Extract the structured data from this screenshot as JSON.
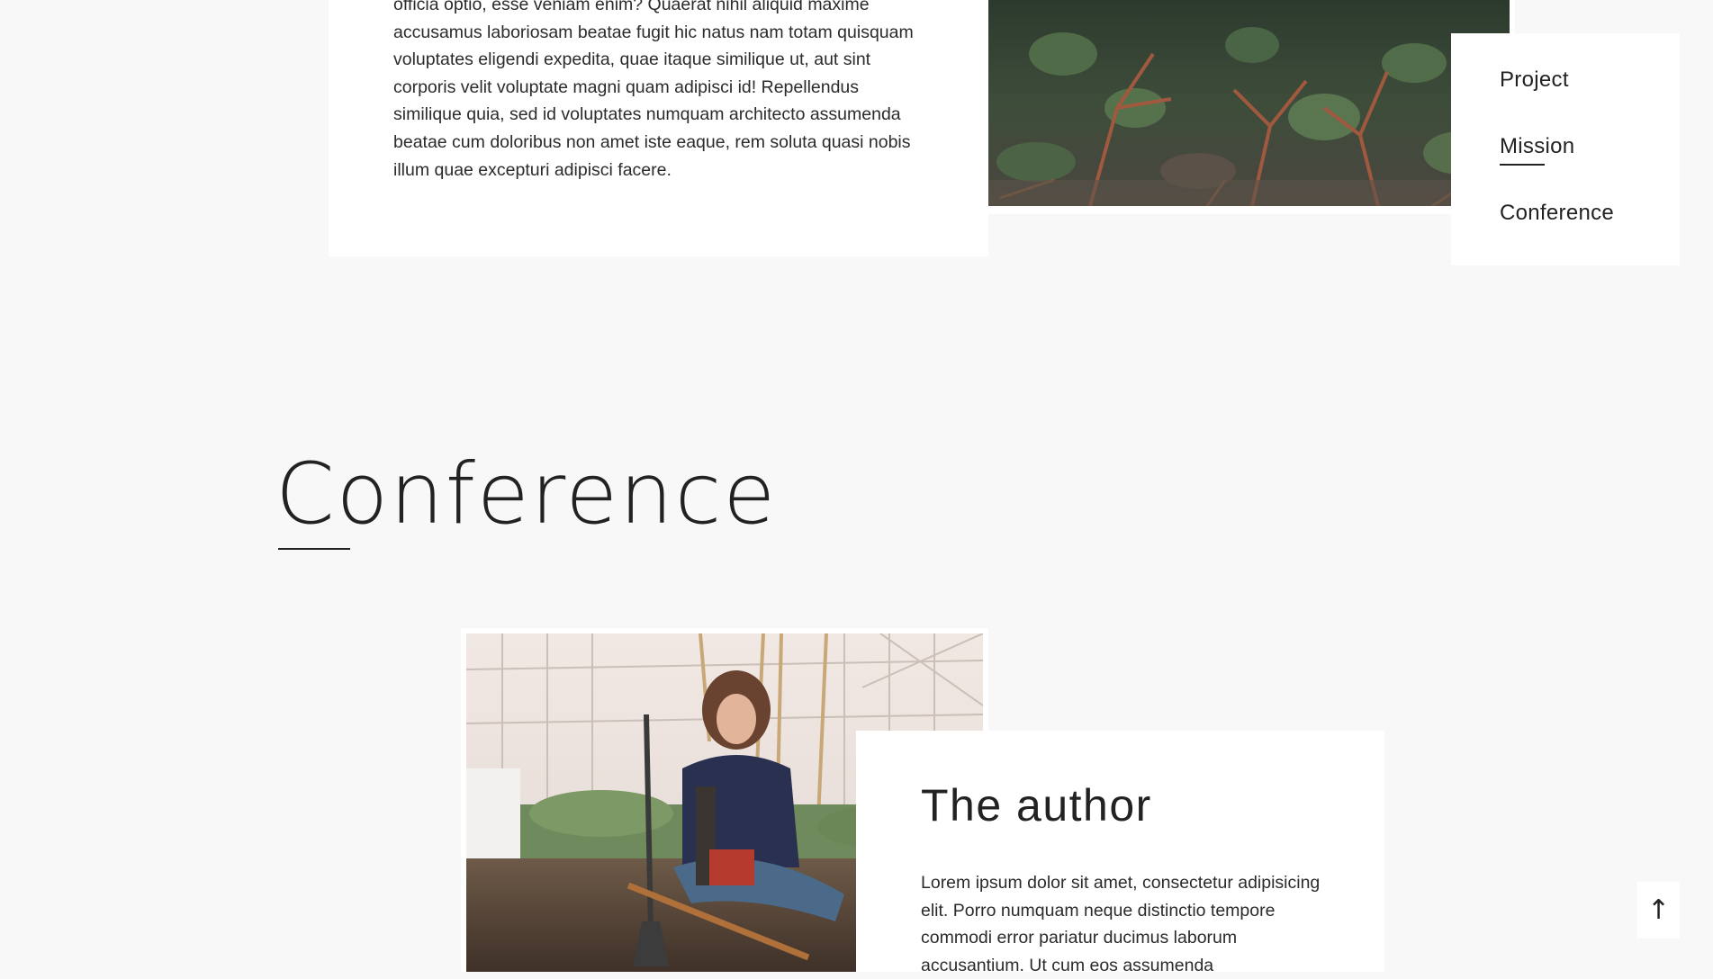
{
  "top_card": {
    "paragraph": "officia optio, esse veniam enim? Quaerat nihil aliquid maxime accusamus laboriosam beatae fugit hic natus nam totam quisquam voluptates eligendi expedita, quae itaque similique ut, aut sint corporis velit voluptate magni quam adipisci id! Repellendus similique quia, sed id voluptates numquam architecto assumenda beatae cum doloribus non amet iste eaque, rem soluta quasi nobis illum quae excepturi adipisci facere."
  },
  "nav": {
    "items": [
      {
        "label": "Project"
      },
      {
        "label": "Mission"
      },
      {
        "label": "Conference"
      }
    ],
    "active": "Mission"
  },
  "section": {
    "title": "Conference"
  },
  "author_card": {
    "heading": "The author",
    "paragraph": "Lorem ipsum dolor sit amet, consectetur adipisicing elit. Porro numquam neque distinctio tempore commodi error pariatur ducimus laborum accusantium. Ut cum eos assumenda"
  },
  "to_top": {
    "icon": "↑"
  },
  "colors": {
    "background": "#f8f8f8",
    "card": "#ffffff",
    "text": "#222222"
  }
}
